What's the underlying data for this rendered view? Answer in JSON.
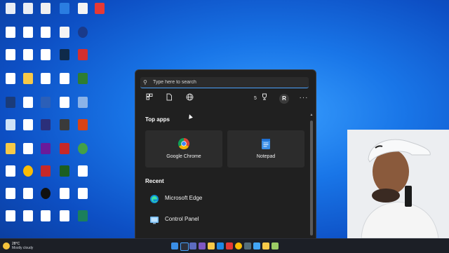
{
  "search": {
    "placeholder": "Type here to search"
  },
  "filter_bar": {
    "points": "5",
    "account_initial": "R",
    "more_label": "···"
  },
  "top_apps": {
    "title": "Top apps",
    "items": [
      {
        "label": "Google Chrome",
        "icon": "chrome-icon"
      },
      {
        "label": "Notepad",
        "icon": "notepad-icon"
      }
    ]
  },
  "recent": {
    "title": "Recent",
    "items": [
      {
        "label": "Microsoft Edge",
        "icon": "edge-icon"
      },
      {
        "label": "Control Panel",
        "icon": "control-panel-icon"
      }
    ]
  },
  "weather": {
    "temp": "28°C",
    "desc": "Mostly cloudy"
  },
  "colors": {
    "accent": "#4aa3ff",
    "panel_bg": "#202020",
    "tile_bg": "#2c2c2c",
    "taskbar_bg": "#1c1f26"
  }
}
